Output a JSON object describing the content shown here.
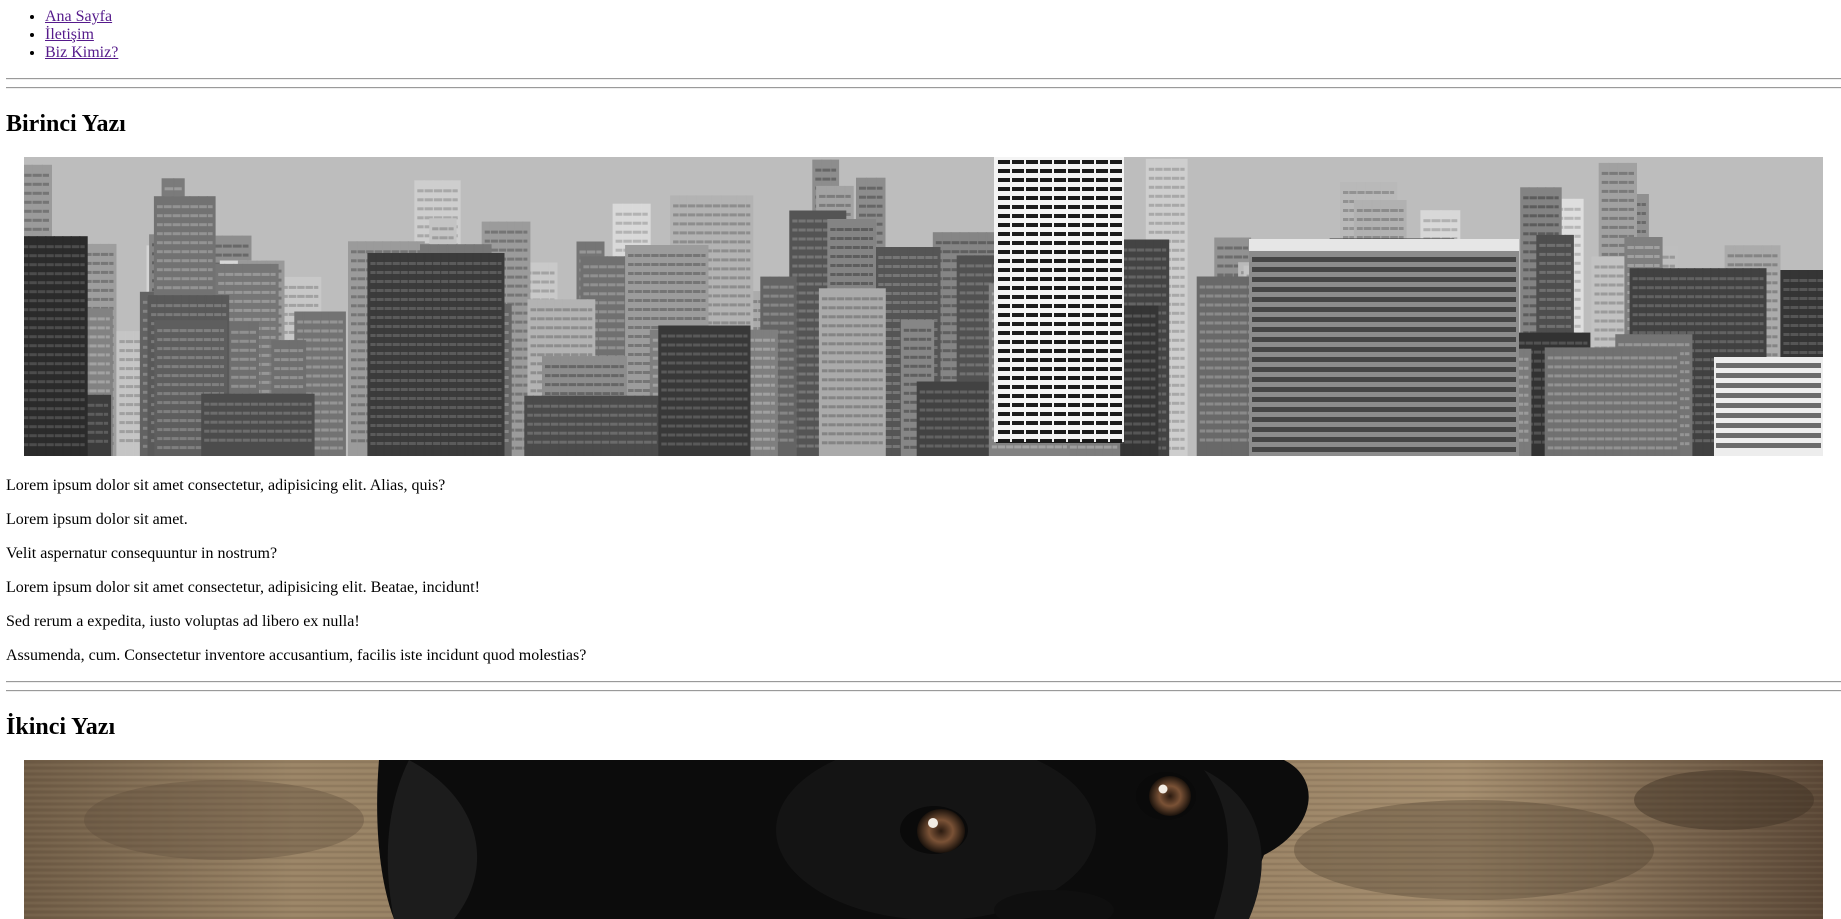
{
  "nav": {
    "items": [
      {
        "label": "Ana Sayfa"
      },
      {
        "label": "İletişim"
      },
      {
        "label": "Biz Kimiz?"
      }
    ]
  },
  "posts": [
    {
      "title": "Birinci Yazı",
      "image": "city-skyline-grayscale-image",
      "paragraphs": [
        "Lorem ipsum dolor sit amet consectetur, adipisicing elit. Alias, quis?",
        "Lorem ipsum dolor sit amet.",
        "Velit aspernatur consequuntur in nostrum?",
        "Lorem ipsum dolor sit amet consectetur, adipisicing elit. Beatae, incidunt!",
        "Sed rerum a expedita, iusto voluptas ad libero ex nulla!",
        "Assumenda, cum. Consectetur inventore accusantium, facilis iste incidunt quod molestias?"
      ]
    },
    {
      "title": "İkinci Yazı",
      "image": "black-dog-on-wood-image"
    }
  ],
  "colors": {
    "link_visited": "#551a8b",
    "rule": "#9a9a9a"
  }
}
